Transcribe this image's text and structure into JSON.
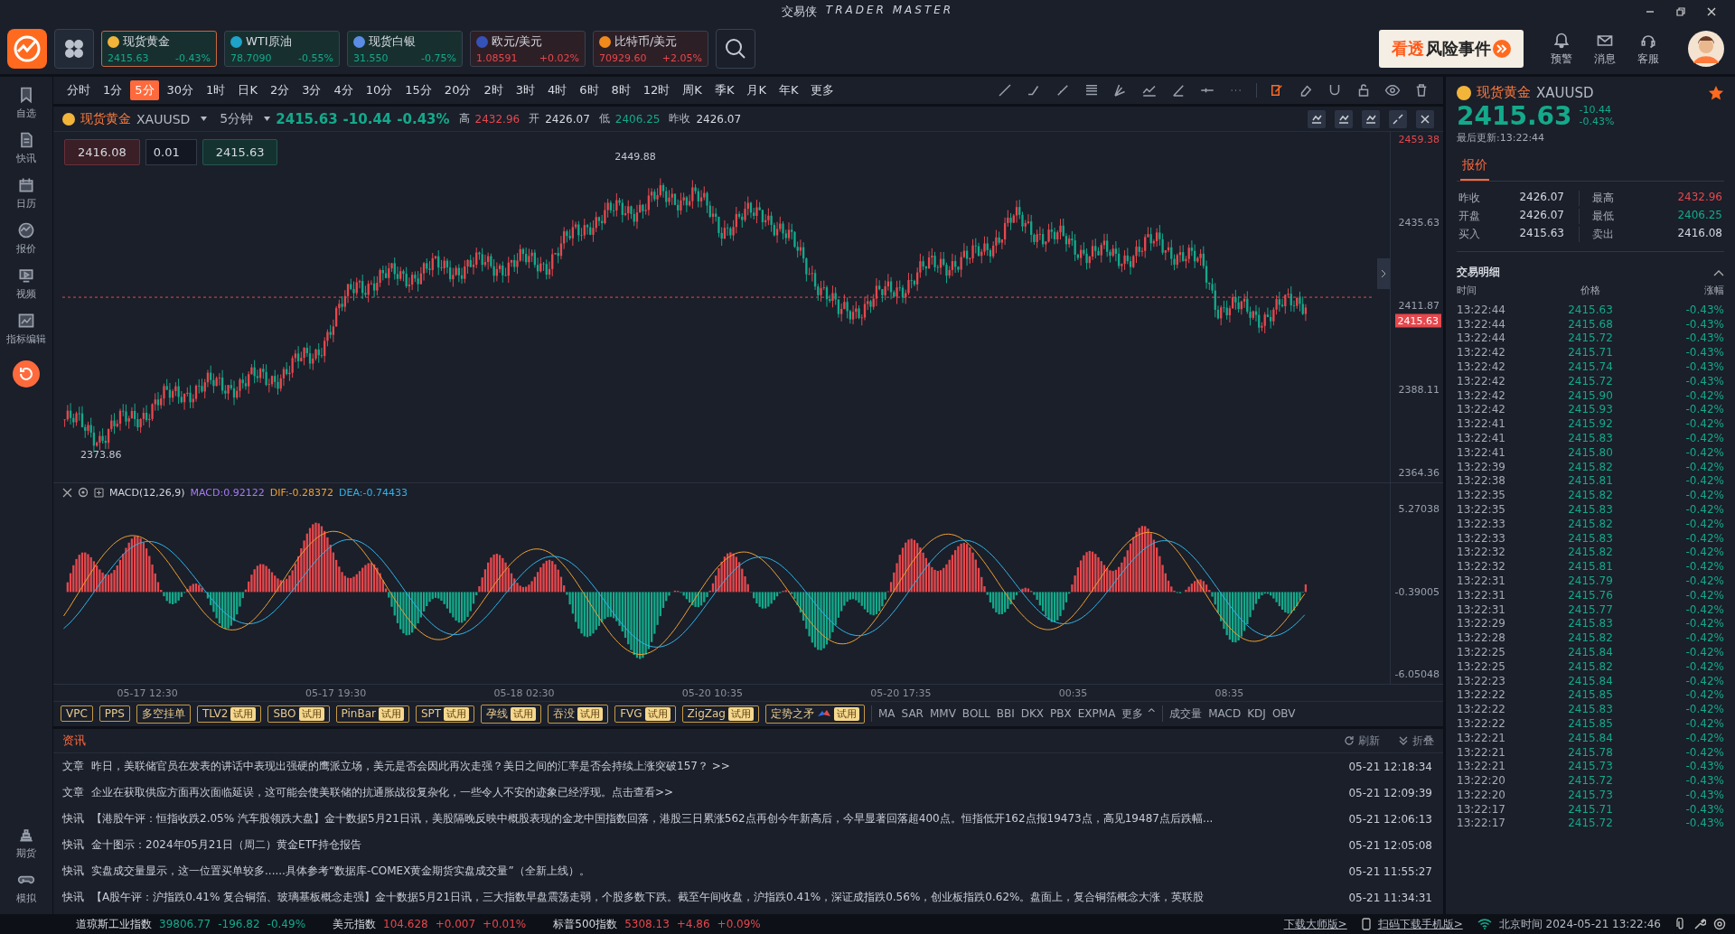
{
  "window": {
    "app": "交易侠",
    "brand": "TRADER MASTER"
  },
  "quotes": [
    {
      "name": "现货黄金",
      "price": "2415.63",
      "pct": "-0.43%",
      "rising": false,
      "color": "#f2b53a",
      "selected": true
    },
    {
      "name": "WTI原油",
      "price": "78.7090",
      "pct": "-0.55%",
      "rising": false,
      "color": "#1fa3c9",
      "selected": false
    },
    {
      "name": "现货白银",
      "price": "31.550",
      "pct": "-0.75%",
      "rising": false,
      "color": "#5b8de6",
      "selected": false
    },
    {
      "name": "欧元/美元",
      "price": "1.08591",
      "pct": "+0.02%",
      "rising": true,
      "color": "#3552b8",
      "selected": false
    },
    {
      "name": "比特币/美元",
      "price": "70929.60",
      "pct": "+2.05%",
      "rising": true,
      "color": "#f08a1c",
      "selected": false
    }
  ],
  "banner": {
    "accent": "看透",
    "text": "风险事件"
  },
  "top_actions": [
    {
      "label": "预警",
      "kind": "bell"
    },
    {
      "label": "消息",
      "kind": "mail"
    },
    {
      "label": "客服",
      "kind": "headset"
    }
  ],
  "sidebar": {
    "items": [
      {
        "label": "自选",
        "kind": "bookmark"
      },
      {
        "label": "快讯",
        "kind": "doc"
      },
      {
        "label": "日历",
        "kind": "calendar"
      },
      {
        "label": "报价",
        "kind": "pulse"
      },
      {
        "label": "视频",
        "kind": "video"
      },
      {
        "label": "指标编辑",
        "kind": "chart"
      }
    ],
    "bottom": [
      {
        "label": "期货",
        "kind": "bars"
      },
      {
        "label": "模拟",
        "kind": "gamepad"
      }
    ]
  },
  "periods": [
    {
      "label": "分时",
      "selected": false
    },
    {
      "label": "1分",
      "selected": false
    },
    {
      "label": "5分",
      "selected": true
    },
    {
      "label": "30分",
      "selected": false
    },
    {
      "label": "1时",
      "selected": false
    },
    {
      "label": "日K",
      "selected": false
    },
    {
      "label": "2分",
      "selected": false
    },
    {
      "label": "3分",
      "selected": false
    },
    {
      "label": "4分",
      "selected": false
    },
    {
      "label": "10分",
      "selected": false
    },
    {
      "label": "15分",
      "selected": false
    },
    {
      "label": "20分",
      "selected": false
    },
    {
      "label": "2时",
      "selected": false
    },
    {
      "label": "3时",
      "selected": false
    },
    {
      "label": "4时",
      "selected": false
    },
    {
      "label": "6时",
      "selected": false
    },
    {
      "label": "8时",
      "selected": false
    },
    {
      "label": "12时",
      "selected": false
    },
    {
      "label": "周K",
      "selected": false
    },
    {
      "label": "季K",
      "selected": false
    },
    {
      "label": "月K",
      "selected": false
    },
    {
      "label": "年K",
      "selected": false
    },
    {
      "label": "更多",
      "selected": false
    }
  ],
  "chart": {
    "symbol": "现货黄金",
    "code": "XAUUSD",
    "period": "5分钟",
    "price": "2415.63",
    "change": "-10.44",
    "pct": "-0.43%",
    "rising": false,
    "stats": [
      {
        "label": "高",
        "value": "2432.96",
        "color": "#e5484d"
      },
      {
        "label": "开",
        "value": "2426.07",
        "color": "#d6d9e0"
      },
      {
        "label": "低",
        "value": "2406.25",
        "color": "#14a98b"
      },
      {
        "label": "昨收",
        "value": "2426.07",
        "color": "#d6d9e0"
      }
    ],
    "order": {
      "sell": "2416.08",
      "lot": "0.01",
      "buy": "2415.63"
    },
    "price_axis": [
      "2459.38",
      "2435.63",
      "2411.87",
      "2388.11",
      "2364.36"
    ],
    "current_tag": "2415.63",
    "high_label": "2449.88",
    "low_label": "2373.86"
  },
  "macd": {
    "title": "MACD(12,26,9)",
    "macd": "MACD:0.92122",
    "dif": "DIF:-0.28372",
    "dea": "DEA:-0.74433",
    "axis": [
      "5.27038",
      "-0.39005",
      "-6.05048"
    ]
  },
  "time_axis": [
    "05-17 12:30",
    "05-17 19:30",
    "05-18 02:30",
    "05-20 10:35",
    "05-20 17:35",
    "00:35",
    "08:35"
  ],
  "indicator_tags": [
    {
      "label": "VPC"
    },
    {
      "label": "PPS"
    },
    {
      "label": "多空挂单"
    },
    {
      "label": "TLV2",
      "badge": "试用"
    },
    {
      "label": "SBO",
      "badge": "试用"
    },
    {
      "label": "PinBar",
      "badge": "试用"
    },
    {
      "label": "SPT",
      "badge": "试用"
    },
    {
      "label": "孕线",
      "badge": "试用"
    },
    {
      "label": "吞没",
      "badge": "试用"
    },
    {
      "label": "FVG",
      "badge": "试用"
    },
    {
      "label": "ZigZag",
      "badge": "试用"
    },
    {
      "label": "定势之矛",
      "badge": "试用",
      "flag": true
    }
  ],
  "main_indicators": [
    "MA",
    "SAR",
    "MMV",
    "BOLL",
    "BBI",
    "DKX",
    "PBX",
    "EXPMA",
    "更多 ^"
  ],
  "sub_indicators": [
    "成交量",
    "MACD",
    "KDJ",
    "OBV"
  ],
  "news": {
    "title": "资讯",
    "refresh": "刷新",
    "fold": "折叠",
    "items": [
      {
        "type": "文章",
        "text": "昨日，美联储官员在发表的讲话中表现出强硬的鹰派立场，美元是否会因此再次走强？美日之间的汇率是否会持续上涨突破157？ >>",
        "time": "05-21 12:18:34"
      },
      {
        "type": "文章",
        "text": "企业在获取供应方面再次面临延误，这可能会使美联储的抗通胀战役复杂化，一些令人不安的迹象已经浮现。点击查看>>",
        "time": "05-21 12:09:39"
      },
      {
        "type": "快讯",
        "text": "【港股午评：恒指收跌2.05% 汽车股领跌大盘】金十数据5月21日讯，美股隔晚反映中概股表现的金龙中国指数回落，港股三日累涨562点再创今年新高后，今早显著回落超400点。恒指低开162点报19473点，高见19487点后跌幅...",
        "time": "05-21 12:06:13"
      },
      {
        "type": "快讯",
        "text": "金十图示：2024年05月21日（周二）黄金ETF持仓报告",
        "time": "05-21 12:05:08"
      },
      {
        "type": "快讯",
        "text": "实盘成交量显示，这一位置买单较多......具体参考“数据库-COMEX黄金期货实盘成交量”（全新上线）。",
        "time": "05-21 11:55:27"
      },
      {
        "type": "快讯",
        "text": "【A股午评：沪指跌0.41% 复合铜箔、玻璃基板概念走强】金十数据5月21日讯，三大指数早盘震荡走弱，个股多数下跌。截至午间收盘，沪指跌0.41%，深证成指跌0.56%，创业板指跌0.62%。盘面上，复合铜箔概念大涨，英联股",
        "time": "05-21 11:34:31"
      }
    ]
  },
  "status_bar": {
    "indices": [
      {
        "name": "道琼斯工业指数",
        "value": "39806.77",
        "change": "-196.82",
        "pct": "-0.49%",
        "rising": false
      },
      {
        "name": "美元指数",
        "value": "104.628",
        "change": "+0.007",
        "pct": "+0.01%",
        "rising": true
      },
      {
        "name": "标普500指数",
        "value": "5308.13",
        "change": "+4.86",
        "pct": "+0.09%",
        "rising": true
      }
    ],
    "download": "下载大师版>",
    "mobile": "扫码下载手机版>",
    "clock": "北京时间 2024-05-21 13:22:46"
  },
  "quote_panel": {
    "symbol": "现货黄金",
    "code": "XAUUSD",
    "price": "2415.63",
    "change": "-10.44",
    "pct": "-0.43%",
    "rising": false,
    "updated": "最后更新:13:22:44",
    "tab": "报价",
    "stats": [
      {
        "label": "昨收",
        "value": "2426.07",
        "color": "#d6d9e0"
      },
      {
        "label": "最高",
        "value": "2432.96",
        "color": "#e5484d"
      },
      {
        "label": "开盘",
        "value": "2426.07",
        "color": "#d6d9e0"
      },
      {
        "label": "最低",
        "value": "2406.25",
        "color": "#14a98b"
      },
      {
        "label": "买入",
        "value": "2415.63",
        "color": "#d6d9e0"
      },
      {
        "label": "卖出",
        "value": "2416.08",
        "color": "#d6d9e0"
      }
    ],
    "trades_title": "交易明细",
    "columns": [
      "时间",
      "价格",
      "涨幅"
    ],
    "trades": [
      [
        "13:22:44",
        "2415.63",
        "-0.43%"
      ],
      [
        "13:22:44",
        "2415.68",
        "-0.43%"
      ],
      [
        "13:22:44",
        "2415.72",
        "-0.43%"
      ],
      [
        "13:22:42",
        "2415.71",
        "-0.43%"
      ],
      [
        "13:22:42",
        "2415.74",
        "-0.43%"
      ],
      [
        "13:22:42",
        "2415.72",
        "-0.43%"
      ],
      [
        "13:22:42",
        "2415.90",
        "-0.42%"
      ],
      [
        "13:22:42",
        "2415.93",
        "-0.42%"
      ],
      [
        "13:22:41",
        "2415.92",
        "-0.42%"
      ],
      [
        "13:22:41",
        "2415.83",
        "-0.42%"
      ],
      [
        "13:22:41",
        "2415.80",
        "-0.42%"
      ],
      [
        "13:22:39",
        "2415.82",
        "-0.42%"
      ],
      [
        "13:22:38",
        "2415.81",
        "-0.42%"
      ],
      [
        "13:22:35",
        "2415.82",
        "-0.42%"
      ],
      [
        "13:22:35",
        "2415.83",
        "-0.42%"
      ],
      [
        "13:22:33",
        "2415.82",
        "-0.42%"
      ],
      [
        "13:22:33",
        "2415.83",
        "-0.42%"
      ],
      [
        "13:22:32",
        "2415.82",
        "-0.42%"
      ],
      [
        "13:22:32",
        "2415.81",
        "-0.42%"
      ],
      [
        "13:22:31",
        "2415.79",
        "-0.42%"
      ],
      [
        "13:22:31",
        "2415.76",
        "-0.42%"
      ],
      [
        "13:22:31",
        "2415.77",
        "-0.42%"
      ],
      [
        "13:22:29",
        "2415.83",
        "-0.42%"
      ],
      [
        "13:22:28",
        "2415.82",
        "-0.42%"
      ],
      [
        "13:22:25",
        "2415.84",
        "-0.42%"
      ],
      [
        "13:22:25",
        "2415.82",
        "-0.42%"
      ],
      [
        "13:22:23",
        "2415.84",
        "-0.42%"
      ],
      [
        "13:22:22",
        "2415.85",
        "-0.42%"
      ],
      [
        "13:22:22",
        "2415.83",
        "-0.42%"
      ],
      [
        "13:22:22",
        "2415.85",
        "-0.42%"
      ],
      [
        "13:22:21",
        "2415.84",
        "-0.42%"
      ],
      [
        "13:22:21",
        "2415.78",
        "-0.42%"
      ],
      [
        "13:22:21",
        "2415.73",
        "-0.43%"
      ],
      [
        "13:22:20",
        "2415.72",
        "-0.43%"
      ],
      [
        "13:22:20",
        "2415.73",
        "-0.43%"
      ],
      [
        "13:22:17",
        "2415.71",
        "-0.43%"
      ],
      [
        "13:22:17",
        "2415.72",
        "-0.43%"
      ]
    ]
  }
}
